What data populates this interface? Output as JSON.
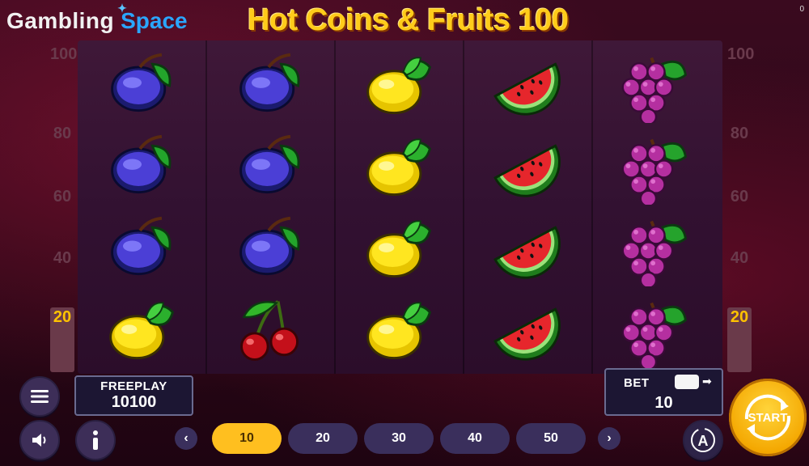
{
  "header": {
    "brand_part1": "Gambling",
    "brand_part2": "Space",
    "game_title": "Hot Coins & Fruits 100",
    "corner_text": "0"
  },
  "reels": [
    [
      "plum",
      "plum",
      "plum",
      "lemon"
    ],
    [
      "plum",
      "plum",
      "plum",
      "cherry"
    ],
    [
      "lemon",
      "lemon",
      "lemon",
      "lemon"
    ],
    [
      "watermelon",
      "watermelon",
      "watermelon",
      "watermelon"
    ],
    [
      "grapes",
      "grapes",
      "grapes",
      "grapes"
    ]
  ],
  "paylines": {
    "left": [
      "100",
      "80",
      "60",
      "40",
      "20"
    ],
    "right": [
      "100",
      "80",
      "60",
      "40",
      "20"
    ],
    "active": "20"
  },
  "freeplay": {
    "label": "FREEPLAY",
    "value": "10100"
  },
  "bet": {
    "label": "BET",
    "value": "10"
  },
  "bet_options": [
    "10",
    "20",
    "30",
    "40",
    "50"
  ],
  "selected_bet": "10",
  "buttons": {
    "start": "START",
    "prev": "‹",
    "next": "›",
    "menu_icon": "menu-icon",
    "sound_icon": "speaker-icon",
    "info_icon": "info-icon",
    "autoplay_icon": "autoplay-icon"
  },
  "colors": {
    "accent": "#ffbf1f",
    "panel_border": "#6a6a90",
    "brand_blue": "#2aa6ff"
  }
}
